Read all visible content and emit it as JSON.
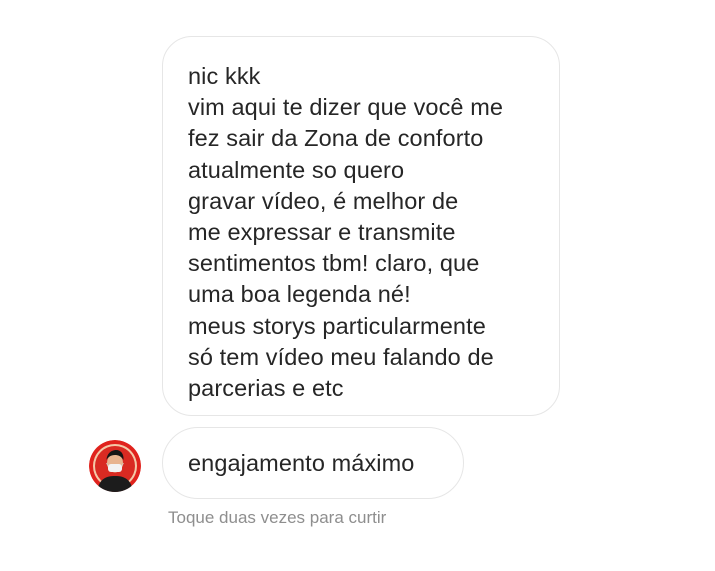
{
  "conversation": {
    "messages": [
      {
        "lines": [
          "nic kkk",
          "vim aqui te dizer que você me",
          "fez sair da Zona de conforto",
          "atualmente so quero",
          "gravar vídeo, é melhor de",
          "me expressar e transmite",
          "sentimentos tbm! claro, que",
          "uma boa legenda né!",
          "meus storys particularmente",
          "só tem vídeo meu falando de",
          "parcerias e etc"
        ]
      },
      {
        "lines": [
          "engajamento máximo"
        ]
      }
    ],
    "avatar_icon": "profile-avatar-icon",
    "double_tap_hint": "Toque duas vezes para curtir"
  },
  "colors": {
    "bubble_border": "#e6e6e6",
    "text": "#262626",
    "hint_text": "#8e8e8e",
    "avatar_ring": "#e0231d"
  }
}
